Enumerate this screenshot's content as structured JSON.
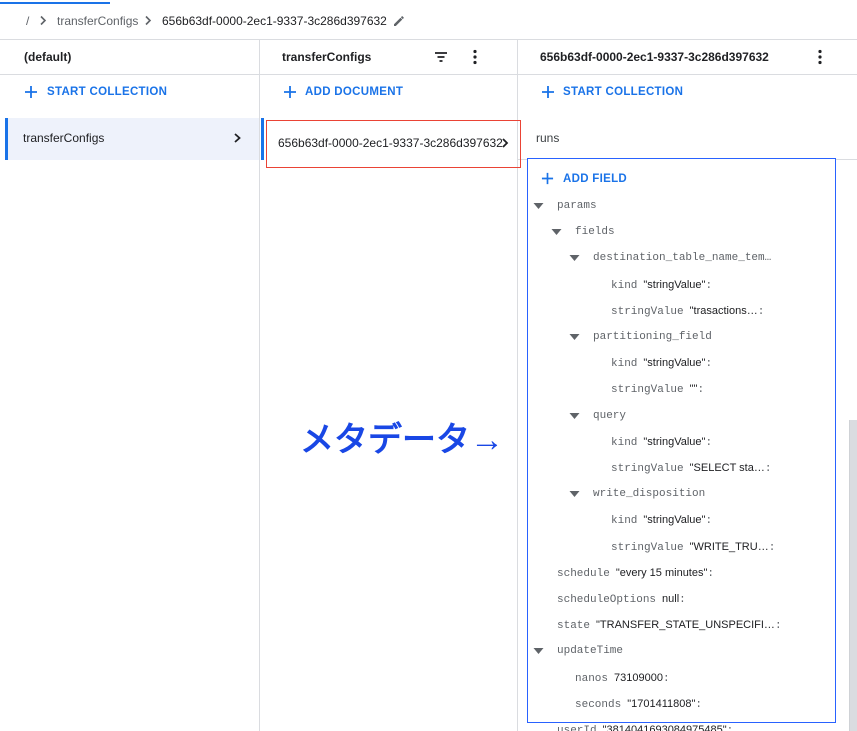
{
  "breadcrumb": {
    "root": "/",
    "items": [
      "transferConfigs",
      "656b63df-0000-2ec1-9337-3c286d397632"
    ]
  },
  "columns": [
    {
      "header": "(default)",
      "action": "START COLLECTION",
      "items": [
        {
          "label": "transferConfigs",
          "selected": true
        }
      ]
    },
    {
      "header": "transferConfigs",
      "action": "ADD DOCUMENT",
      "items": [
        {
          "label": "656b63df-0000-2ec1-9337-3c286d397632",
          "selected": true
        }
      ]
    },
    {
      "header": "656b63df-0000-2ec1-9337-3c286d397632",
      "action": "START COLLECTION",
      "subcollections": [
        "runs"
      ],
      "add_field": "ADD FIELD",
      "fields": [
        {
          "key": "params",
          "children": [
            {
              "key": "fields",
              "children": [
                {
                  "key": "destination_table_name_tem…",
                  "children": [
                    {
                      "key": "kind",
                      "value": "\"stringValue\""
                    },
                    {
                      "key": "stringValue",
                      "value": "\"trasactions…"
                    }
                  ]
                },
                {
                  "key": "partitioning_field",
                  "children": [
                    {
                      "key": "kind",
                      "value": "\"stringValue\""
                    },
                    {
                      "key": "stringValue",
                      "value": "\"\""
                    }
                  ]
                },
                {
                  "key": "query",
                  "children": [
                    {
                      "key": "kind",
                      "value": "\"stringValue\""
                    },
                    {
                      "key": "stringValue",
                      "value": "\"SELECT sta…"
                    }
                  ]
                },
                {
                  "key": "write_disposition",
                  "children": [
                    {
                      "key": "kind",
                      "value": "\"stringValue\""
                    },
                    {
                      "key": "stringValue",
                      "value": "\"WRITE_TRU…"
                    }
                  ]
                }
              ]
            }
          ]
        },
        {
          "key": "schedule",
          "value": "\"every 15 minutes\""
        },
        {
          "key": "scheduleOptions",
          "value": "null"
        },
        {
          "key": "state",
          "value": "\"TRANSFER_STATE_UNSPECIFI…"
        },
        {
          "key": "updateTime",
          "children": [
            {
              "key": "nanos",
              "value": "73109000"
            },
            {
              "key": "seconds",
              "value": "\"1701411808\""
            }
          ]
        },
        {
          "key": "userId",
          "value": "\"3814041693084975485\""
        }
      ]
    }
  ],
  "annotation": "メタデータ→",
  "icons": [
    "chevron-right-icon",
    "edit-pencil-icon",
    "filter-icon",
    "more-vert-icon",
    "add-icon",
    "expand-arrow-icon"
  ],
  "colors": {
    "accent": "#1a73e8",
    "highlight_red": "#ea4335",
    "highlight_blue": "#2962ff",
    "annotation": "#1947e5"
  }
}
